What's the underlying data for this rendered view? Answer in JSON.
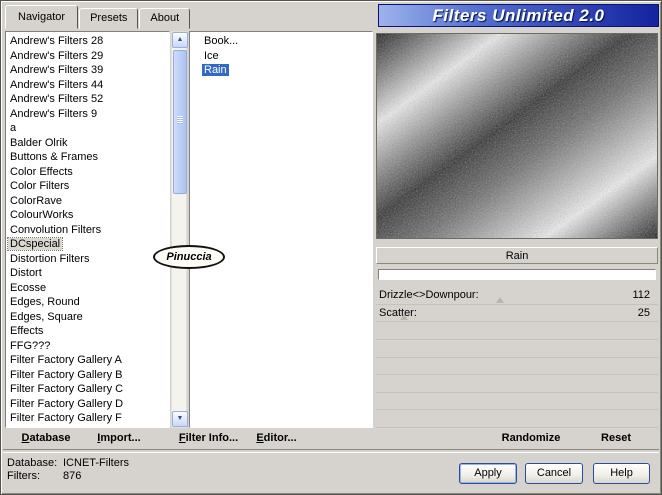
{
  "window": {
    "title": "Filters Unlimited 2.0"
  },
  "tabs": [
    {
      "label": "Navigator",
      "selected": true
    },
    {
      "label": "Presets",
      "selected": false
    },
    {
      "label": "About",
      "selected": false
    }
  ],
  "navigator": {
    "categories": [
      {
        "label": "Andrew's Filters 28",
        "selected": false
      },
      {
        "label": "Andrew's Filters 29",
        "selected": false
      },
      {
        "label": "Andrew's Filters 39",
        "selected": false
      },
      {
        "label": "Andrew's Filters 44",
        "selected": false
      },
      {
        "label": "Andrew's Filters 52",
        "selected": false
      },
      {
        "label": "Andrew's Filters 9",
        "selected": false
      },
      {
        "label": "a",
        "selected": false
      },
      {
        "label": "Balder Olrik",
        "selected": false
      },
      {
        "label": "Buttons & Frames",
        "selected": false
      },
      {
        "label": "Color Effects",
        "selected": false
      },
      {
        "label": "Color Filters",
        "selected": false
      },
      {
        "label": "ColorRave",
        "selected": false
      },
      {
        "label": "ColourWorks",
        "selected": false
      },
      {
        "label": "Convolution Filters",
        "selected": false
      },
      {
        "label": "DCspecial",
        "selected": true
      },
      {
        "label": "Distortion Filters",
        "selected": false
      },
      {
        "label": "Distort",
        "selected": false
      },
      {
        "label": "Ecosse",
        "selected": false
      },
      {
        "label": "Edges, Round",
        "selected": false
      },
      {
        "label": "Edges, Square",
        "selected": false
      },
      {
        "label": "Effects",
        "selected": false
      },
      {
        "label": "FFG???",
        "selected": false
      },
      {
        "label": "Filter Factory Gallery A",
        "selected": false
      },
      {
        "label": "Filter Factory Gallery B",
        "selected": false
      },
      {
        "label": "Filter Factory Gallery C",
        "selected": false
      },
      {
        "label": "Filter Factory Gallery D",
        "selected": false
      },
      {
        "label": "Filter Factory Gallery F",
        "selected": false
      }
    ],
    "filters": [
      {
        "label": "Book...",
        "selected": false
      },
      {
        "label": "Ice",
        "selected": false
      },
      {
        "label": "Rain",
        "selected": true
      }
    ],
    "watermark": "Pinuccia"
  },
  "preview": {
    "filter_name": "Rain",
    "progress_percent": 0
  },
  "parameters": {
    "rows": [
      {
        "label": "Drizzle<>Downpour:",
        "value": "112",
        "marker_percent": 44
      },
      {
        "label": "Scatter:",
        "value": "25",
        "marker_percent": 10
      },
      {
        "label": "",
        "value": ""
      },
      {
        "label": "",
        "value": ""
      },
      {
        "label": "",
        "value": ""
      },
      {
        "label": "",
        "value": ""
      },
      {
        "label": "",
        "value": ""
      },
      {
        "label": "",
        "value": ""
      }
    ],
    "randomize": "Randomize",
    "reset": "Reset"
  },
  "toolbar": {
    "database": "Database",
    "import": "Import...",
    "filter_info": "Filter Info...",
    "editor": "Editor..."
  },
  "status": {
    "database_label": "Database:",
    "database_value": "ICNET-Filters",
    "filters_label": "Filters:",
    "filters_value": "876"
  },
  "buttons": {
    "apply": "Apply",
    "cancel": "Cancel",
    "help": "Help"
  },
  "colors": {
    "selection": "#316ac5",
    "banner_start": "#9db3ee",
    "banner_end": "#14239e",
    "background": "#d6d3ce"
  }
}
